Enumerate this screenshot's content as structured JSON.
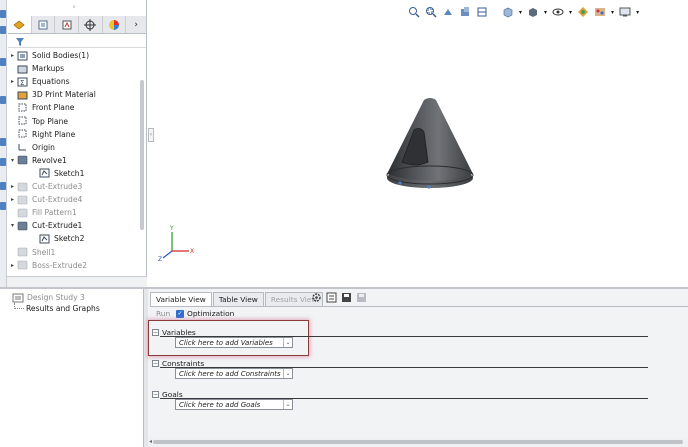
{
  "feature_tree": {
    "items": [
      {
        "label": "Solid Bodies(1)",
        "icon": "solid-bodies-icon",
        "expandable": true,
        "suppressed": false,
        "indent": 0
      },
      {
        "label": "Markups",
        "icon": "markups-icon",
        "expandable": false,
        "suppressed": false,
        "indent": 0
      },
      {
        "label": "Equations",
        "icon": "equations-icon",
        "expandable": true,
        "suppressed": false,
        "indent": 0
      },
      {
        "label": "3D Print Material",
        "icon": "material-icon",
        "expandable": false,
        "suppressed": false,
        "indent": 0
      },
      {
        "label": "Front Plane",
        "icon": "plane-icon",
        "expandable": false,
        "suppressed": false,
        "indent": 0
      },
      {
        "label": "Top Plane",
        "icon": "plane-icon",
        "expandable": false,
        "suppressed": false,
        "indent": 0
      },
      {
        "label": "Right Plane",
        "icon": "plane-icon",
        "expandable": false,
        "suppressed": false,
        "indent": 0
      },
      {
        "label": "Origin",
        "icon": "origin-icon",
        "expandable": false,
        "suppressed": false,
        "indent": 0
      },
      {
        "label": "Revolve1",
        "icon": "revolve-icon",
        "expandable": true,
        "expanded": true,
        "suppressed": false,
        "indent": 0
      },
      {
        "label": "Sketch1",
        "icon": "sketch-icon",
        "expandable": false,
        "suppressed": false,
        "indent": 1
      },
      {
        "label": "Cut-Extrude3",
        "icon": "cut-extrude-icon",
        "expandable": true,
        "suppressed": true,
        "indent": 0
      },
      {
        "label": "Cut-Extrude4",
        "icon": "cut-extrude-icon",
        "expandable": true,
        "suppressed": true,
        "indent": 0
      },
      {
        "label": "Fill Pattern1",
        "icon": "fill-pattern-icon",
        "expandable": false,
        "suppressed": true,
        "indent": 0
      },
      {
        "label": "Cut-Extrude1",
        "icon": "cut-extrude-icon",
        "expandable": true,
        "expanded": true,
        "suppressed": false,
        "indent": 0
      },
      {
        "label": "Sketch2",
        "icon": "sketch-icon",
        "expandable": false,
        "suppressed": false,
        "indent": 1
      },
      {
        "label": "Shell1",
        "icon": "shell-icon",
        "expandable": false,
        "suppressed": true,
        "indent": 0
      },
      {
        "label": "Boss-Extrude2",
        "icon": "boss-extrude-icon",
        "expandable": true,
        "suppressed": true,
        "indent": 0
      }
    ]
  },
  "study_tree": {
    "root": "Design Study 3",
    "child": "Results and Graphs"
  },
  "design_study": {
    "tabs": [
      {
        "label": "Variable View",
        "state": "active"
      },
      {
        "label": "Table View",
        "state": "normal"
      },
      {
        "label": "Results View",
        "state": "disabled"
      }
    ],
    "run_label": "Run",
    "optimization_label": "Optimization",
    "optimization_checked": true,
    "sections": [
      {
        "title": "Variables",
        "combo": "Click here to add Variables"
      },
      {
        "title": "Constraints",
        "combo": "Click here to add Constraints"
      },
      {
        "title": "Goals",
        "combo": "Click here to add Goals"
      }
    ]
  },
  "colors": {
    "accent": "#4f80bf",
    "highlight_border": "#8a3a3a",
    "part_fill": "#4a4d50"
  }
}
